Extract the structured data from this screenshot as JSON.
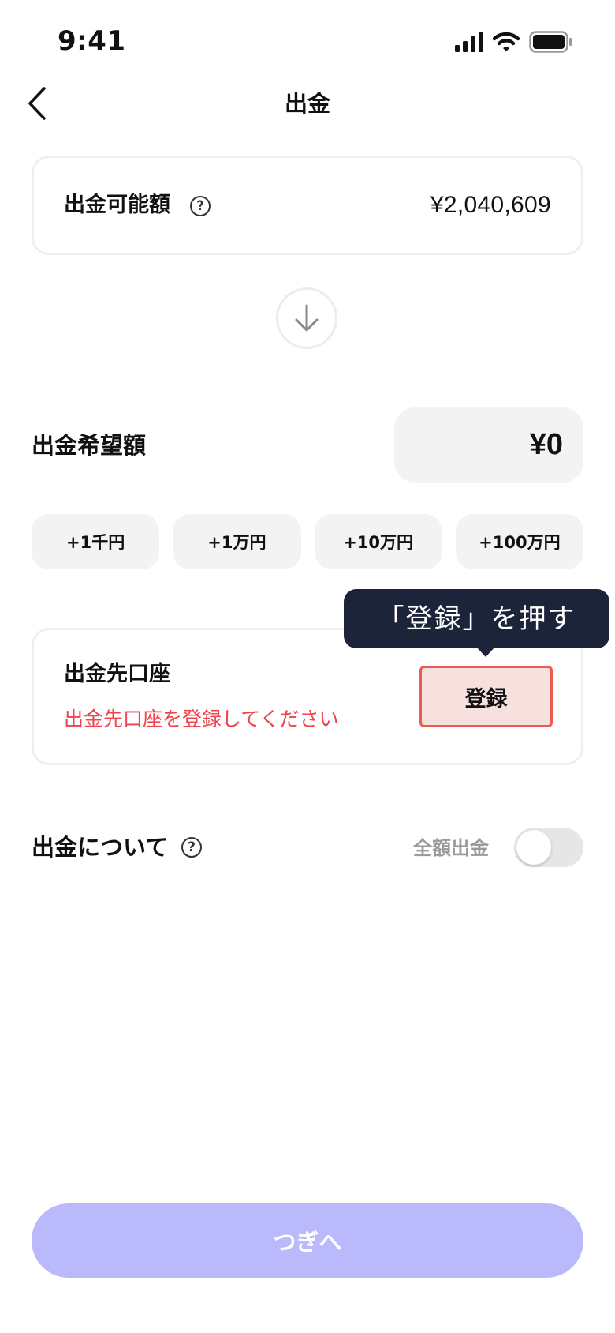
{
  "status_bar": {
    "time": "9:41",
    "icons": [
      "signal-icon",
      "wifi-icon",
      "battery-icon"
    ]
  },
  "header": {
    "back_icon": "chevron-left-icon",
    "title": "出金"
  },
  "available": {
    "label": "出金可能額",
    "help_icon_glyph": "?",
    "value": "¥2,040,609"
  },
  "arrow_icon": "arrow-down-icon",
  "desired": {
    "label": "出金希望額",
    "value": "¥0"
  },
  "quick_add": {
    "buttons": [
      "+1千円",
      "+1万円",
      "+10万円",
      "+100万円"
    ]
  },
  "account": {
    "label": "出金先口座",
    "error": "出金先口座を登録してください",
    "register_label": "登録"
  },
  "tooltip": {
    "text": "「登録」を押す"
  },
  "about": {
    "label": "出金について",
    "help_icon_glyph": "?",
    "full_amount_label": "全額出金",
    "full_amount_toggle_on": false
  },
  "next_button": {
    "label": "つぎへ"
  },
  "colors": {
    "error_text": "#f0434c",
    "register_bg": "#f7e1df",
    "register_border": "#ec5a52",
    "tooltip_bg": "#1b2438",
    "next_button_bg": "#b9b9fc",
    "field_bg": "#f3f3f3"
  }
}
